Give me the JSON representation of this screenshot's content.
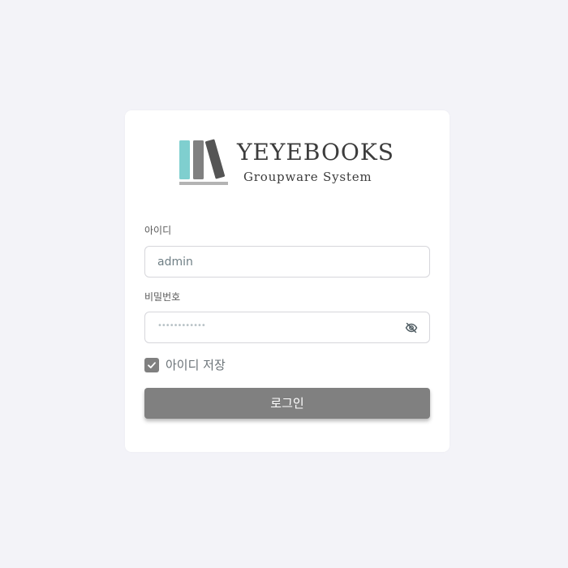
{
  "brand": {
    "name": "YEYEBOOKS",
    "subtitle": "Groupware System",
    "logo_icon": "books-icon"
  },
  "form": {
    "id_label": "아이디",
    "id_value": "admin",
    "password_label": "비밀번호",
    "password_mask": "••••••••••••",
    "password_toggle_icon": "eye-off-icon",
    "remember_label": "아이디 저장",
    "remember_checked": true,
    "login_button": "로그인"
  },
  "colors": {
    "background": "#f3f3f8",
    "card": "#ffffff",
    "button": "#808080",
    "book_teal": "#7fcfcf",
    "book_gray": "#808080",
    "book_dark": "#555555"
  }
}
